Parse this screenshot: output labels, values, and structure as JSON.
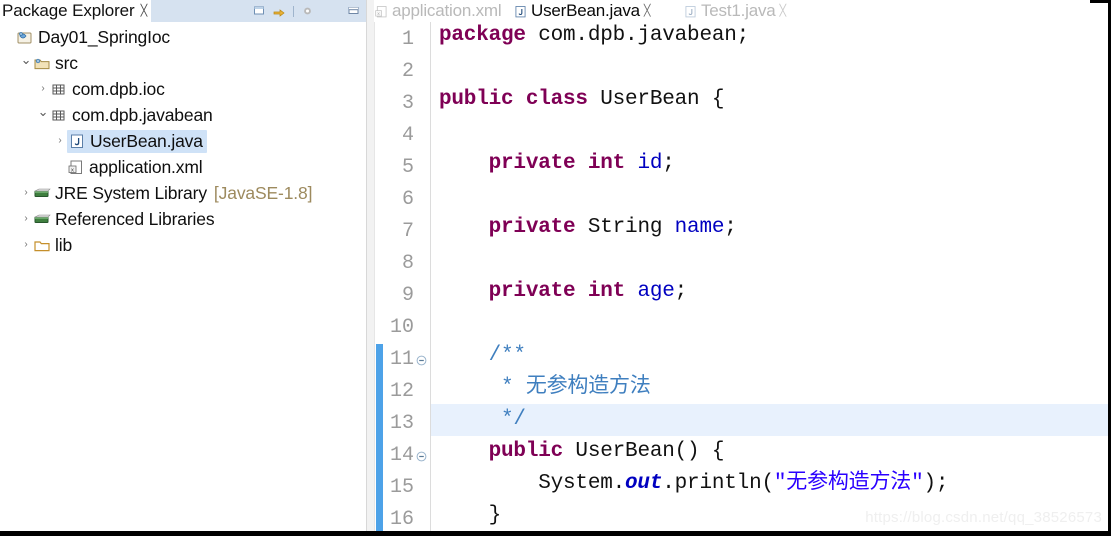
{
  "explorer": {
    "tab": {
      "title": "Package Explorer",
      "close_glyph": "╳"
    },
    "toolbar": [
      {
        "name": "collapse-all-icon"
      },
      {
        "name": "link-with-editor-icon"
      },
      {
        "name": "view-menu-icon"
      },
      {
        "name": "minimize-icon"
      }
    ],
    "tree": [
      {
        "label": "Day01_SpringIoc",
        "arrow": "",
        "icon": "java-project-icon",
        "indent": 0,
        "selected": false,
        "suffix": ""
      },
      {
        "label": "src",
        "arrow": "⌄",
        "icon": "source-folder-icon",
        "indent": 1,
        "selected": false,
        "suffix": ""
      },
      {
        "label": "com.dpb.ioc",
        "arrow": "›",
        "icon": "package-icon",
        "indent": 2,
        "selected": false,
        "suffix": ""
      },
      {
        "label": "com.dpb.javabean",
        "arrow": "⌄",
        "icon": "package-icon",
        "indent": 2,
        "selected": false,
        "suffix": ""
      },
      {
        "label": "UserBean.java",
        "arrow": "›",
        "icon": "java-file-icon",
        "indent": 3,
        "selected": true,
        "suffix": ""
      },
      {
        "label": "application.xml",
        "arrow": "",
        "icon": "xml-file-icon",
        "indent": 3,
        "selected": false,
        "suffix": ""
      },
      {
        "label": "JRE System Library",
        "arrow": "›",
        "icon": "library-icon",
        "indent": 1,
        "selected": false,
        "suffix": "[JavaSE-1.8]"
      },
      {
        "label": "Referenced Libraries",
        "arrow": "›",
        "icon": "library-icon",
        "indent": 1,
        "selected": false,
        "suffix": ""
      },
      {
        "label": "lib",
        "arrow": "›",
        "icon": "folder-icon",
        "indent": 1,
        "selected": false,
        "suffix": ""
      }
    ]
  },
  "editor": {
    "tabs": [
      {
        "label": "application.xml",
        "icon": "xml-file-icon",
        "active": false,
        "closable": false
      },
      {
        "label": "UserBean.java",
        "icon": "java-file-icon",
        "active": true,
        "closable": true
      },
      {
        "label": "Test1.java",
        "icon": "java-file-icon",
        "active": false,
        "closable": true
      }
    ],
    "current_line": 13,
    "change_marker_lines": [
      11,
      16
    ],
    "fold_lines": [
      11,
      14
    ],
    "lines": [
      {
        "n": 1,
        "tokens": [
          {
            "t": "package",
            "c": "kw"
          },
          {
            "t": " com.dpb.javabean;",
            "c": "pln"
          }
        ]
      },
      {
        "n": 2,
        "tokens": []
      },
      {
        "n": 3,
        "tokens": [
          {
            "t": "public class",
            "c": "kw"
          },
          {
            "t": " UserBean {",
            "c": "pln"
          }
        ]
      },
      {
        "n": 4,
        "tokens": []
      },
      {
        "n": 5,
        "tokens": [
          {
            "t": "    ",
            "c": "pln"
          },
          {
            "t": "private int",
            "c": "kw"
          },
          {
            "t": " ",
            "c": "pln"
          },
          {
            "t": "id",
            "c": "fld"
          },
          {
            "t": ";",
            "c": "pln"
          }
        ]
      },
      {
        "n": 6,
        "tokens": []
      },
      {
        "n": 7,
        "tokens": [
          {
            "t": "    ",
            "c": "pln"
          },
          {
            "t": "private",
            "c": "kw"
          },
          {
            "t": " String ",
            "c": "pln"
          },
          {
            "t": "name",
            "c": "fld"
          },
          {
            "t": ";",
            "c": "pln"
          }
        ]
      },
      {
        "n": 8,
        "tokens": []
      },
      {
        "n": 9,
        "tokens": [
          {
            "t": "    ",
            "c": "pln"
          },
          {
            "t": "private int",
            "c": "kw"
          },
          {
            "t": " ",
            "c": "pln"
          },
          {
            "t": "age",
            "c": "fld"
          },
          {
            "t": ";",
            "c": "pln"
          }
        ]
      },
      {
        "n": 10,
        "tokens": []
      },
      {
        "n": 11,
        "tokens": [
          {
            "t": "    /**",
            "c": "cmt"
          }
        ]
      },
      {
        "n": 12,
        "tokens": [
          {
            "t": "     * 无参构造方法",
            "c": "cmt"
          }
        ]
      },
      {
        "n": 13,
        "tokens": [
          {
            "t": "     */",
            "c": "cmt"
          }
        ]
      },
      {
        "n": 14,
        "tokens": [
          {
            "t": "    ",
            "c": "pln"
          },
          {
            "t": "public",
            "c": "kw"
          },
          {
            "t": " UserBean() {",
            "c": "pln"
          }
        ]
      },
      {
        "n": 15,
        "tokens": [
          {
            "t": "        System.",
            "c": "pln"
          },
          {
            "t": "out",
            "c": "stat"
          },
          {
            "t": ".println(",
            "c": "pln"
          },
          {
            "t": "\"无参构造方法\"",
            "c": "str"
          },
          {
            "t": ");",
            "c": "pln"
          }
        ]
      },
      {
        "n": 16,
        "tokens": [
          {
            "t": "    }",
            "c": "pln"
          }
        ]
      }
    ]
  },
  "watermark": "https://blog.csdn.net/qq_38526573",
  "colors": {
    "keyword": "#7f0055",
    "field": "#0000c0",
    "string": "#2a00ff",
    "comment": "#3f7fbf",
    "selection": "#cfe2f7",
    "current_line": "#e8f1fd",
    "change_marker": "#4da2e8",
    "tab_header": "#d6e2f0"
  }
}
